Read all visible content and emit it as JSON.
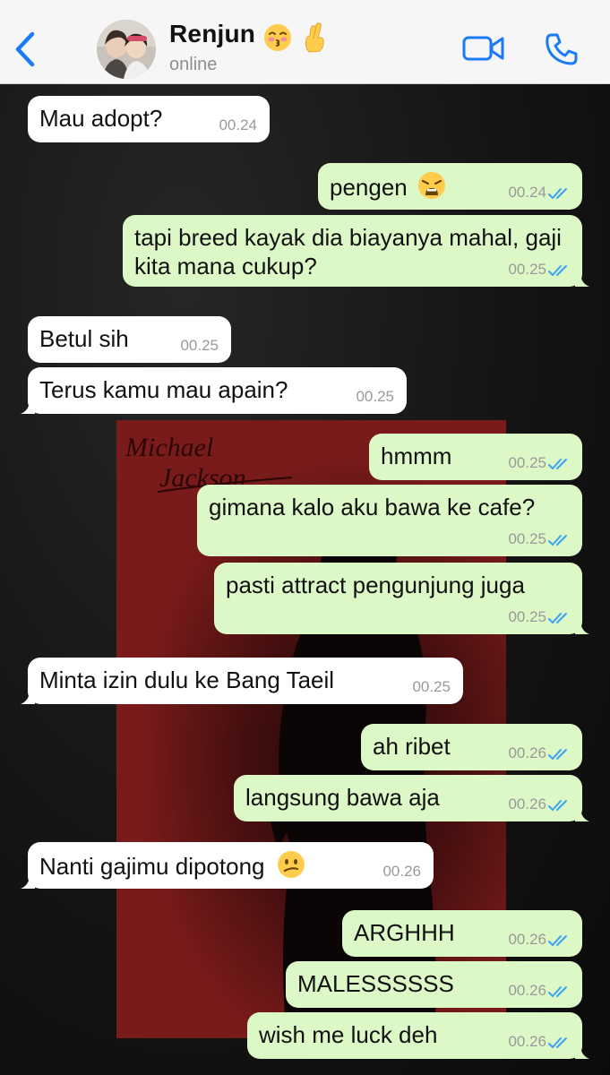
{
  "header": {
    "contact_name": "Renjun",
    "status": "online",
    "emoji_1": "kissing-face-emoji",
    "emoji_2": "crossed-fingers-emoji",
    "icons": {
      "back": "chevron-left-icon",
      "video": "video-camera-icon",
      "call": "phone-icon"
    },
    "accent_color": "#1a7cf5"
  },
  "colors": {
    "incoming": "#ffffff",
    "outgoing": "#dcf8c6",
    "read_ticks": "#3aa3f2"
  },
  "wallpaper": {
    "poster_text_line1": "Michael",
    "poster_text_line2": "Jackson"
  },
  "messages": [
    {
      "dir": "in",
      "text": "Mau adopt?",
      "time": "00.24"
    },
    {
      "dir": "out",
      "text": "pengen",
      "emoji": "weary-face-emoji",
      "time": "00.24",
      "read": true
    },
    {
      "dir": "out",
      "text": "tapi breed kayak dia biayanya mahal, gaji kita mana cukup?",
      "time": "00.25",
      "read": true
    },
    {
      "dir": "in",
      "text": "Betul sih",
      "time": "00.25"
    },
    {
      "dir": "in",
      "text": "Terus kamu mau apain?",
      "time": "00.25"
    },
    {
      "dir": "out",
      "text": "hmmm",
      "time": "00.25",
      "read": true
    },
    {
      "dir": "out",
      "text": "gimana kalo aku bawa ke cafe?",
      "time": "00.25",
      "read": true
    },
    {
      "dir": "out",
      "text": "pasti attract pengunjung juga",
      "time": "00.25",
      "read": true
    },
    {
      "dir": "in",
      "text": "Minta izin dulu ke Bang Taeil",
      "time": "00.25"
    },
    {
      "dir": "out",
      "text": "ah ribet",
      "time": "00.26",
      "read": true
    },
    {
      "dir": "out",
      "text": "langsung bawa aja",
      "time": "00.26",
      "read": true
    },
    {
      "dir": "in",
      "text": "Nanti gajimu dipotong",
      "emoji": "confused-face-emoji",
      "time": "00.26"
    },
    {
      "dir": "out",
      "text": "ARGHHH",
      "time": "00.26",
      "read": true
    },
    {
      "dir": "out",
      "text": "MALESSSSSS",
      "time": "00.26",
      "read": true
    },
    {
      "dir": "out",
      "text": "wish me luck deh",
      "time": "00.26",
      "read": true
    }
  ]
}
